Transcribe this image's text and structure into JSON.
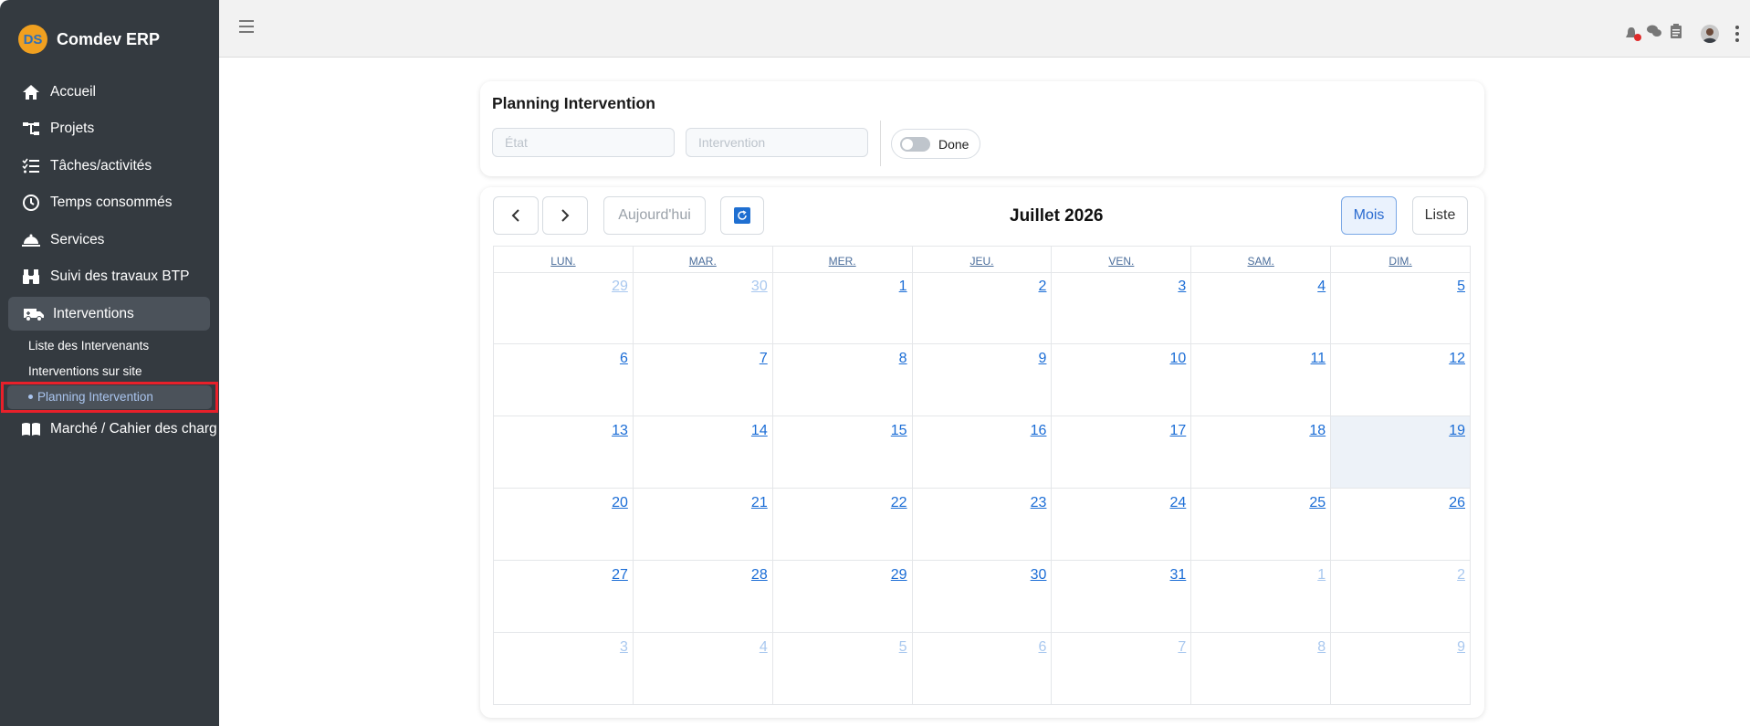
{
  "brand": {
    "logo_text": "DS",
    "name": "Comdev ERP"
  },
  "nav": {
    "items": [
      {
        "label": "Accueil",
        "icon": "home-icon"
      },
      {
        "label": "Projets",
        "icon": "sitemap-icon"
      },
      {
        "label": "Tâches/activités",
        "icon": "tasks-icon"
      },
      {
        "label": "Temps consommés",
        "icon": "clock-icon"
      },
      {
        "label": "Services",
        "icon": "bell-service-icon"
      },
      {
        "label": "Suivi des travaux BTP",
        "icon": "binoculars-icon"
      },
      {
        "label": "Interventions",
        "icon": "truck-icon"
      },
      {
        "label": "Marché / Cahier des charg",
        "icon": "book-icon"
      }
    ],
    "sub_items": [
      {
        "label": "Liste des Intervenants"
      },
      {
        "label": "Interventions sur site"
      },
      {
        "label": "Planning Intervention"
      }
    ]
  },
  "topbar": {
    "icons": [
      "notification-icon",
      "chat-icon",
      "clipboard-icon",
      "avatar",
      "kebab-menu-icon"
    ]
  },
  "filters": {
    "title": "Planning Intervention",
    "etat_placeholder": "État",
    "intervention_placeholder": "Intervention",
    "done_label": "Done",
    "done_on": false
  },
  "calendar": {
    "today_label": "Aujourd'hui",
    "title": "Juillet 2026",
    "view_month": "Mois",
    "view_list": "Liste",
    "weekdays": [
      "LUN.",
      "MAR.",
      "MER.",
      "JEU.",
      "VEN.",
      "SAM.",
      "DIM."
    ],
    "weeks": [
      [
        {
          "d": "29",
          "o": true
        },
        {
          "d": "30",
          "o": true
        },
        {
          "d": "1"
        },
        {
          "d": "2"
        },
        {
          "d": "3"
        },
        {
          "d": "4"
        },
        {
          "d": "5"
        }
      ],
      [
        {
          "d": "6"
        },
        {
          "d": "7"
        },
        {
          "d": "8"
        },
        {
          "d": "9"
        },
        {
          "d": "10"
        },
        {
          "d": "11"
        },
        {
          "d": "12"
        }
      ],
      [
        {
          "d": "13"
        },
        {
          "d": "14"
        },
        {
          "d": "15"
        },
        {
          "d": "16"
        },
        {
          "d": "17"
        },
        {
          "d": "18"
        },
        {
          "d": "19",
          "today": true
        }
      ],
      [
        {
          "d": "20"
        },
        {
          "d": "21"
        },
        {
          "d": "22"
        },
        {
          "d": "23"
        },
        {
          "d": "24"
        },
        {
          "d": "25"
        },
        {
          "d": "26"
        }
      ],
      [
        {
          "d": "27"
        },
        {
          "d": "28"
        },
        {
          "d": "29"
        },
        {
          "d": "30"
        },
        {
          "d": "31"
        },
        {
          "d": "1",
          "o": true
        },
        {
          "d": "2",
          "o": true
        }
      ],
      [
        {
          "d": "3",
          "o": true
        },
        {
          "d": "4",
          "o": true
        },
        {
          "d": "5",
          "o": true
        },
        {
          "d": "6",
          "o": true
        },
        {
          "d": "7",
          "o": true
        },
        {
          "d": "8",
          "o": true
        },
        {
          "d": "9",
          "o": true
        }
      ]
    ]
  },
  "colors": {
    "sidebar": "#343a40",
    "accent": "#1b6dd6",
    "highlight": "#e8202a"
  }
}
